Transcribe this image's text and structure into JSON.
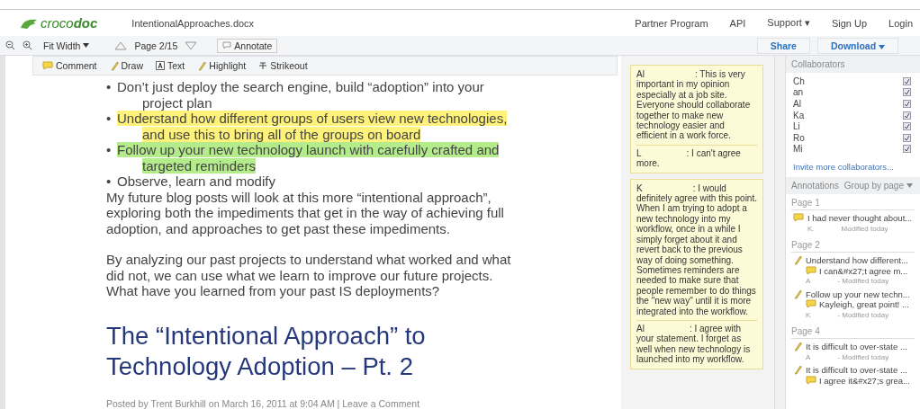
{
  "header": {
    "logo": "croco**doc**",
    "filename": "IntentionalApproaches.docx",
    "nav": [
      "Partner Program",
      "API",
      "Support ▾",
      "Sign Up",
      "Login"
    ]
  },
  "toolbar": {
    "zoom_mode": "Fit Width",
    "page": "Page 2/15",
    "annotate": "Annotate",
    "share": "Share",
    "download": "Download"
  },
  "annotation_tools": [
    {
      "label": "Comment",
      "kind": "comment"
    },
    {
      "label": "Draw",
      "kind": "draw"
    },
    {
      "label": "Text",
      "kind": "text"
    },
    {
      "label": "Highlight",
      "kind": "highlight"
    },
    {
      "label": "Strikeout",
      "kind": "strikeout"
    }
  ],
  "document": {
    "bullets": [
      {
        "bullet": "•",
        "text": "Don’t just deploy the search engine, build “adoption” into your project plan"
      },
      {
        "bullet": "•",
        "text": "Understand how different groups of users view new technologies, and use this to bring all of the groups on board",
        "color": "#fff27a"
      },
      {
        "bullet": "•",
        "text": "Follow up your new technology launch with carefully crafted and targeted reminders",
        "color": "#b4ec8c"
      },
      {
        "bullet": "•",
        "text": "Observe, learn and modify"
      }
    ],
    "paragraphs": [
      "My future blog posts will look at this more “intentional approach”, exploring both the impediments that get in the way of achieving full adoption, and approaches to get past these impediments.",
      "By analyzing our past projects to understand what worked and what did not, we can use what we learn to improve our future projects.   What have you learned from your past IS deployments?"
    ],
    "title": "The “Intentional Approach” to Technology Adoption – Pt. 2",
    "byline": "Posted by Trent Burkhill on March 16, 2011 at 9:04 AM | Leave a Comment"
  },
  "comments": [
    {
      "author": "Al",
      "text": ": This is very important in my opinion especially at a job site. Everyone should collaborate together to make new technology easier and efficient in a work force.",
      "replies": [
        {
          "author": "L",
          "text": ": I can't agree more."
        }
      ]
    },
    {
      "author": "K",
      "text": ": I would definitely agree with this point. When I am trying to adopt a new technology into my workflow, once in a while I simply forget about it and revert back to the previous way of doing something. Sometimes reminders are needed to make sure that people remember to do things the \"new way\" until it is more integrated into the workflow.",
      "replies": [
        {
          "author": "Al",
          "text": ": I agree with your statement. I forget as well when new technology is launched into my workflow."
        }
      ]
    }
  ],
  "sidebar": {
    "collaborators_title": "Collaborators",
    "collaborators": [
      {
        "name": "Ch",
        "checked": true
      },
      {
        "name": "an",
        "checked": true
      },
      {
        "name": "Al",
        "checked": true
      },
      {
        "name": "Ka",
        "checked": true
      },
      {
        "name": "Li",
        "checked": true
      },
      {
        "name": "Ro",
        "checked": true
      },
      {
        "name": "Mi",
        "checked": true
      }
    ],
    "invite": "Invite more collaborators...",
    "annotations_title": "Annotations",
    "group_by": "Group by page",
    "pages": [
      {
        "label": "Page 1",
        "items": [
          {
            "kind": "comment",
            "text": "I had never thought about...",
            "author": "K.",
            "meta": "Modified today"
          }
        ]
      },
      {
        "label": "Page 2",
        "items": [
          {
            "kind": "highlight",
            "text": "Understand how different...",
            "reply": "I can&#x27;t agree m...",
            "author": "A",
            "meta": "- Modified today"
          },
          {
            "kind": "highlight",
            "text": "Follow up your new techn...",
            "reply": "Kayleigh, great point! ...",
            "author": "K",
            "meta": "- Modified today"
          }
        ]
      },
      {
        "label": "Page 4",
        "items": [
          {
            "kind": "highlight",
            "text": "It is difficult to over-state ...",
            "author": "A",
            "meta": "- Modified today"
          },
          {
            "kind": "highlight",
            "text": "It is difficult to over-state ...",
            "reply": "I agree it&#x27;s grea..."
          }
        ]
      }
    ]
  }
}
